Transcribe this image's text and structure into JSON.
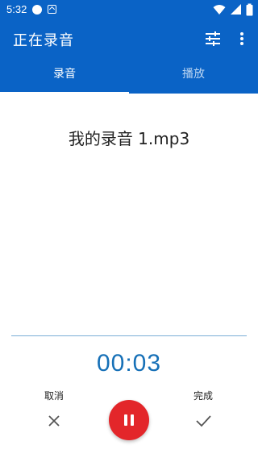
{
  "status_bar": {
    "time": "5:32",
    "icons": [
      "notification-dot-icon",
      "app-notification-icon",
      "wifi-icon",
      "cellular-icon",
      "battery-icon"
    ]
  },
  "app_bar": {
    "title": "正在录音",
    "actions": [
      "tune-icon",
      "more-vert-icon"
    ],
    "background": "#0a63c6"
  },
  "tabs": [
    {
      "label": "录音",
      "active": true
    },
    {
      "label": "播放",
      "active": false
    }
  ],
  "recording": {
    "file_name": "我的录音 1.mp3",
    "elapsed": "00:03"
  },
  "controls": {
    "cancel_label": "取消",
    "done_label": "完成",
    "pause_icon": "pause-icon",
    "pause_color": "#e3262a"
  }
}
